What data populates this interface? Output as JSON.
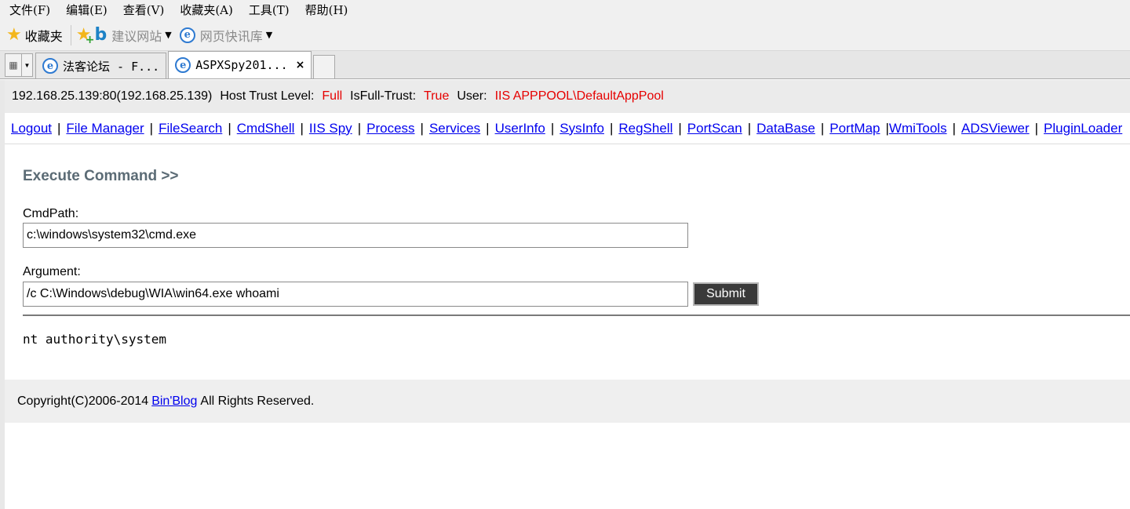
{
  "menu": [
    "文件(F)",
    "编辑(E)",
    "查看(V)",
    "收藏夹(A)",
    "工具(T)",
    "帮助(H)"
  ],
  "favorites": {
    "label": "收藏夹",
    "suggested_sites": "建议网站",
    "web_slice": "网页快讯库"
  },
  "tabs": [
    {
      "title": "法客论坛 - F...",
      "active": false
    },
    {
      "title": "ASPXSpy201...",
      "active": true,
      "close": "×"
    }
  ],
  "info": {
    "host": "192.168.25.139:80(192.168.25.139)",
    "trust_label": "Host Trust Level:",
    "trust_value": "Full",
    "fulltrust_label": "IsFull-Trust:",
    "fulltrust_value": "True",
    "user_label": "User:",
    "user_value": "IIS APPPOOL\\DefaultAppPool"
  },
  "nav": [
    "Logout",
    "File Manager",
    "FileSearch",
    "CmdShell",
    "IIS Spy",
    "Process",
    "Services",
    "UserInfo",
    "SysInfo",
    "RegShell",
    "PortScan",
    "DataBase",
    "PortMap",
    "WmiTools",
    "ADSViewer",
    "PluginLoader"
  ],
  "command": {
    "title": "Execute Command >>",
    "cmdpath_label": "CmdPath:",
    "cmdpath_value": "c:\\windows\\system32\\cmd.exe",
    "argument_label": "Argument:",
    "argument_value": "/c C:\\Windows\\debug\\WIA\\win64.exe whoami",
    "submit_label": "Submit",
    "output": "nt authority\\system"
  },
  "footer": {
    "prefix": "Copyright(C)2006-2014",
    "link": "Bin'Blog",
    "suffix": "All Rights Reserved."
  },
  "colors": {
    "accent_red": "#e60000",
    "link": "#0000ee",
    "title_gray": "#5b6b75"
  }
}
